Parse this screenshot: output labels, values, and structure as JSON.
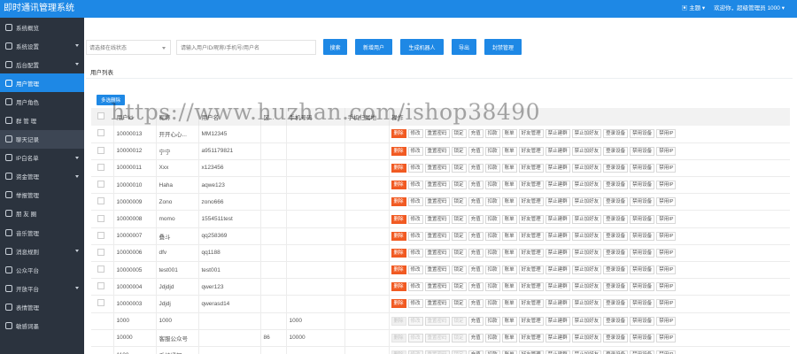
{
  "app": {
    "title": "即时通讯管理系统"
  },
  "header": {
    "theme_label": "主题",
    "welcome": "欢迎你，超级管理员 1000"
  },
  "sidebar": {
    "items": [
      {
        "label": "系统概览",
        "icon": "home-icon",
        "caret": false
      },
      {
        "label": "系统设置",
        "icon": "gear-icon",
        "caret": true
      },
      {
        "label": "后台配置",
        "icon": "folder-icon",
        "caret": true
      },
      {
        "label": "用户管理",
        "icon": "user-icon",
        "caret": false
      },
      {
        "label": "用户角色",
        "icon": "user-role-icon",
        "caret": false
      },
      {
        "label": "群 管 理",
        "icon": "group-icon",
        "caret": false
      },
      {
        "label": "聊天记录",
        "icon": "chat-icon",
        "caret": false
      },
      {
        "label": "IP白名单",
        "icon": "shield-icon",
        "caret": true
      },
      {
        "label": "资金管理",
        "icon": "money-icon",
        "caret": true
      },
      {
        "label": "举报管理",
        "icon": "flag-icon",
        "caret": false
      },
      {
        "label": "朋 友 圈",
        "icon": "moments-icon",
        "caret": false
      },
      {
        "label": "音乐管理",
        "icon": "music-icon",
        "caret": false
      },
      {
        "label": "消息规则",
        "icon": "message-rule-icon",
        "caret": true
      },
      {
        "label": "公众平台",
        "icon": "public-platform-icon",
        "caret": false
      },
      {
        "label": "开放平台",
        "icon": "open-platform-icon",
        "caret": true
      },
      {
        "label": "表情管理",
        "icon": "emoji-icon",
        "caret": false
      },
      {
        "label": "敏感词墨",
        "icon": "sensitive-word-icon",
        "caret": false
      }
    ]
  },
  "toolbar": {
    "status_placeholder": "请选择在线状态",
    "search_placeholder": "请输入用户ID/昵称/手机号/用户名",
    "buttons": [
      "搜索",
      "新增用户",
      "生成机器人",
      "导出",
      "封禁管理"
    ]
  },
  "section": {
    "title": "用户列表",
    "batch_delete": "多选删除"
  },
  "table": {
    "columns": [
      "",
      "用户Id",
      "昵称",
      "用户名",
      "区...",
      "手机号码",
      "手机归属地",
      "操作"
    ],
    "ops": [
      "删除",
      "修改",
      "重置密码",
      "锁定",
      "充值",
      "扣款",
      "账单",
      "好友管理",
      "禁止建群",
      "禁止加好友",
      "登录设备",
      "禁用设备",
      "禁用IP"
    ],
    "rows": [
      {
        "checkbox": true,
        "id": "10000013",
        "nickname": "开开心心...",
        "username": "MM12345",
        "area": "",
        "phone": "",
        "disabled_ops": []
      },
      {
        "checkbox": true,
        "id": "10000012",
        "nickname": "宁宁",
        "username": "a951179821",
        "area": "",
        "phone": "",
        "disabled_ops": []
      },
      {
        "checkbox": true,
        "id": "10000011",
        "nickname": "Xxx",
        "username": "x123456",
        "area": "",
        "phone": "",
        "disabled_ops": []
      },
      {
        "checkbox": true,
        "id": "10000010",
        "nickname": "Haha",
        "username": "aqwe123",
        "area": "",
        "phone": "",
        "disabled_ops": []
      },
      {
        "checkbox": true,
        "id": "10000009",
        "nickname": "Zono",
        "username": "zono666",
        "area": "",
        "phone": "",
        "disabled_ops": []
      },
      {
        "checkbox": true,
        "id": "10000008",
        "nickname": "momo",
        "username": "1554511test",
        "area": "",
        "phone": "",
        "disabled_ops": []
      },
      {
        "checkbox": true,
        "id": "10000007",
        "nickname": "叠斗",
        "username": "qq258369",
        "area": "",
        "phone": "",
        "disabled_ops": []
      },
      {
        "checkbox": true,
        "id": "10000006",
        "nickname": "dfv",
        "username": "qq1188",
        "area": "",
        "phone": "",
        "disabled_ops": []
      },
      {
        "checkbox": true,
        "id": "10000005",
        "nickname": "test001",
        "username": "test001",
        "area": "",
        "phone": "",
        "disabled_ops": []
      },
      {
        "checkbox": true,
        "id": "10000004",
        "nickname": "Jdjdjd",
        "username": "qwer123",
        "area": "",
        "phone": "",
        "disabled_ops": []
      },
      {
        "checkbox": true,
        "id": "10000003",
        "nickname": "Jdjdj",
        "username": "qwerasd14",
        "area": "",
        "phone": "",
        "disabled_ops": []
      },
      {
        "checkbox": false,
        "id": "1000",
        "nickname": "1000",
        "username": "",
        "area": "",
        "phone": "1000",
        "disabled_ops": [
          0,
          1,
          2,
          3
        ]
      },
      {
        "checkbox": false,
        "id": "10000",
        "nickname": "客服公众号",
        "username": "",
        "area": "86",
        "phone": "10000",
        "disabled_ops": [
          0,
          1,
          2,
          3
        ]
      },
      {
        "checkbox": false,
        "id": "1100",
        "nickname": "系统通知",
        "username": "",
        "area": "",
        "phone": "",
        "disabled_ops": [
          0,
          1,
          2,
          3
        ]
      }
    ]
  },
  "watermark": "https://www.huzhan.com/ishop38490",
  "colors": {
    "primary": "#1e88e5",
    "sidebar": "#2b333e",
    "danger": "#f15a22"
  }
}
